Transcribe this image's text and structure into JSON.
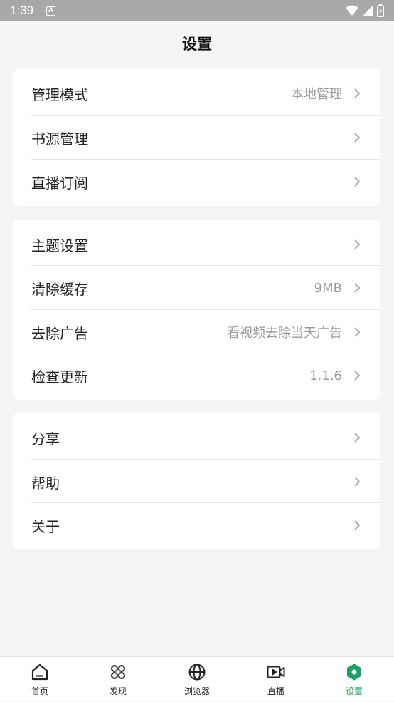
{
  "status_bar": {
    "time": "1:39",
    "badge": "A"
  },
  "page_title": "设置",
  "groups": [
    {
      "items": [
        {
          "label": "管理模式",
          "value": "本地管理"
        },
        {
          "label": "书源管理",
          "value": ""
        },
        {
          "label": "直播订阅",
          "value": ""
        }
      ]
    },
    {
      "items": [
        {
          "label": "主题设置",
          "value": ""
        },
        {
          "label": "清除缓存",
          "value": "9MB"
        },
        {
          "label": "去除广告",
          "value": "看视频去除当天广告"
        },
        {
          "label": "检查更新",
          "value": "1.1.6"
        }
      ]
    },
    {
      "items": [
        {
          "label": "分享",
          "value": ""
        },
        {
          "label": "帮助",
          "value": ""
        },
        {
          "label": "关于",
          "value": ""
        }
      ]
    }
  ],
  "bottom_nav": [
    {
      "label": "首页",
      "icon": "home-icon"
    },
    {
      "label": "发现",
      "icon": "command-icon"
    },
    {
      "label": "浏览器",
      "icon": "globe-icon"
    },
    {
      "label": "直播",
      "icon": "video-camera-icon"
    },
    {
      "label": "设置",
      "icon": "settings-hexagon-icon",
      "active": true
    }
  ],
  "colors": {
    "accent": "#1aa260",
    "status_bar": "#a8a8a8",
    "background": "#f5f5f5"
  }
}
